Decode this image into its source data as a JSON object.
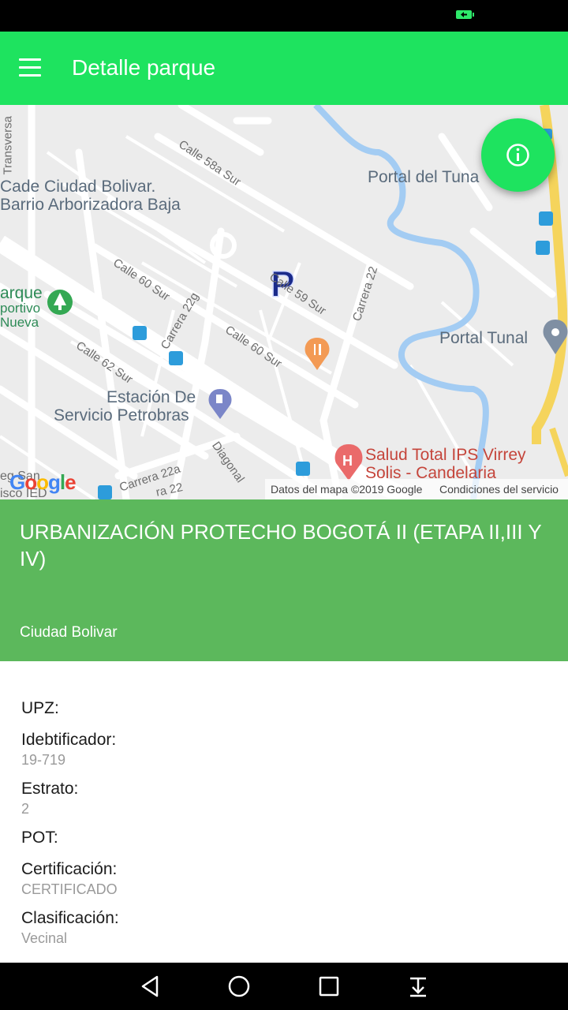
{
  "app_bar": {
    "title": "Detalle parque"
  },
  "map": {
    "labels": {
      "cade": "Cade Ciudad Bolivar.",
      "barrio": "Barrio Arborizadora Baja",
      "portal_tunal_top": "Portal del Tuna",
      "portal_tunal": "Portal Tunal",
      "parque_1": "arque",
      "parque_2": "portivo",
      "parque_3": "Nueva",
      "estacion_1": "Estación De",
      "estacion_2": "Servicio Petrobras",
      "salud_1": "Salud Total IPS Virrey",
      "salud_2": "Solis - Candelaria",
      "transversal": "Transversa",
      "calle_58a": "Calle 58a Sur",
      "calle_60": "Calle 60 Sur",
      "calle_59": "Calle 59 Sur",
      "calle_60b": "Calle 60 Sur",
      "calle_62": "Calle 62 Sur",
      "carrera_22g": "Carrera 22g",
      "carrera_22": "Carrera 22",
      "carrera_22a": "Carrera 22a",
      "diagonal": "Diagonal",
      "cra22_bottom": "ra 22",
      "google_partial_1": "eg San",
      "google_partial_2": "isco IED"
    },
    "google_logo": "Google",
    "credits": {
      "data": "Datos del mapa ©2019 Google",
      "terms": "Condiciones del servicio"
    }
  },
  "park": {
    "name": "URBANIZACIÓN PROTECHO BOGOTÁ II (ETAPA II,III Y IV)",
    "locality": "Ciudad Bolivar"
  },
  "details": [
    {
      "label": "UPZ:",
      "value": ""
    },
    {
      "label": "Idebtificador:",
      "value": "19-719"
    },
    {
      "label": "Estrato:",
      "value": "2"
    },
    {
      "label": "POT:",
      "value": ""
    },
    {
      "label": "Certificación:",
      "value": "CERTIFICADO"
    },
    {
      "label": "Clasificación:",
      "value": "Vecinal"
    }
  ],
  "colors": {
    "primary": "#1ee35f",
    "header_green": "#5cb85c"
  },
  "icons": {
    "menu": "hamburger-menu-icon",
    "info": "info-icon",
    "parking_marker": "parking-marker-icon",
    "nav_back": "back-triangle-icon",
    "nav_home": "home-circle-icon",
    "nav_recents": "recents-square-icon",
    "nav_notifications": "pull-down-icon"
  }
}
